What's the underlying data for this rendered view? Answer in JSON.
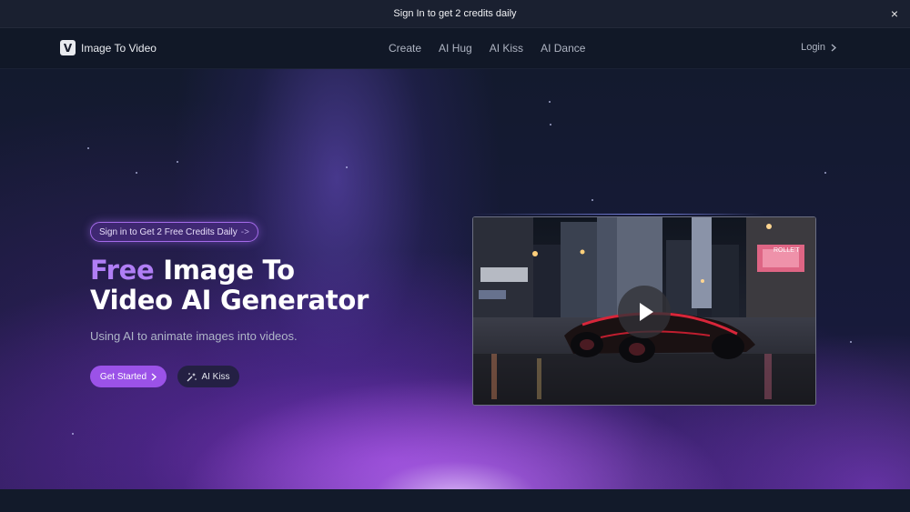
{
  "banner": {
    "text": "Sign In to get 2 credits daily",
    "close_icon": "close-icon"
  },
  "header": {
    "logo_letter": "V",
    "brand": "Image To Video",
    "nav": [
      "Create",
      "AI Hug",
      "AI Kiss",
      "AI Dance"
    ],
    "login": "Login",
    "login_icon": "chevron-right-icon"
  },
  "hero": {
    "badge": "Sign in to Get 2 Free Credits Daily",
    "badge_arrow": "->",
    "title_accent": "Free",
    "title_rest_line1": " Image To",
    "title_line2": "Video AI Generator",
    "subtitle": "Using AI to animate images into videos.",
    "primary_button": "Get Started",
    "primary_icon": "chevron-right-icon",
    "secondary_button": "AI Kiss",
    "secondary_icon": "sparkle-wand-icon"
  },
  "video": {
    "play_icon": "play-icon",
    "billboard_text": "ROLLE'T"
  },
  "colors": {
    "accent": "#9b52e8",
    "accent_text": "#b07ef5",
    "background": "#0f1526",
    "banner_bg": "#1a2030"
  }
}
